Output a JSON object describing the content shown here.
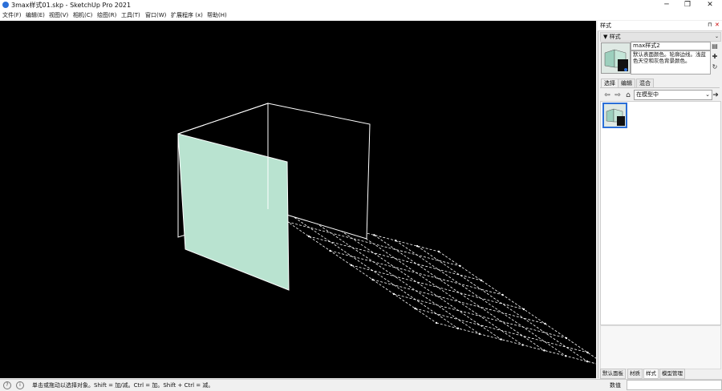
{
  "window": {
    "title": "3max样式01.skp - SketchUp Pro 2021",
    "minimize_glyph": "─",
    "maximize_glyph": "❐",
    "close_glyph": "✕"
  },
  "menu": [
    "文件(F)",
    "编辑(E)",
    "视图(V)",
    "相机(C)",
    "绘图(R)",
    "工具(T)",
    "窗口(W)",
    "扩展程序 (x)",
    "帮助(H)"
  ],
  "panel": {
    "title": "样式",
    "pin_glyph": "⊓",
    "close_glyph": "✕",
    "section_title": "▼ 样式",
    "style_name": "max样式2",
    "style_description": "默认表面颜色。轮廓边线。浅蓝色天空和灰色背景颜色。",
    "tabs": [
      "选择",
      "编辑",
      "混合"
    ],
    "collection_value": "在模型中",
    "bottom_tabs": [
      "默认面板",
      "材质",
      "样式",
      "模型管理"
    ]
  },
  "status": {
    "message": "单击或拖动以选择对象。Shift = 加/减。Ctrl = 加。Shift + Ctrl = 减。",
    "measure_label": "数值",
    "measure_value": ""
  },
  "colors": {
    "viewport_bg": "#000000",
    "face_color": "#b9e3d0",
    "edge_color": "#ffffff",
    "accent": "#2b6fd8"
  },
  "icons": [
    "app-icon",
    "minimize-icon",
    "maximize-icon",
    "close-icon",
    "pin-icon",
    "panel-close-icon",
    "update-style-icon",
    "create-style-icon",
    "refresh-icon",
    "back-icon",
    "forward-icon",
    "home-icon",
    "detail-icon",
    "help-icon",
    "info-icon"
  ]
}
